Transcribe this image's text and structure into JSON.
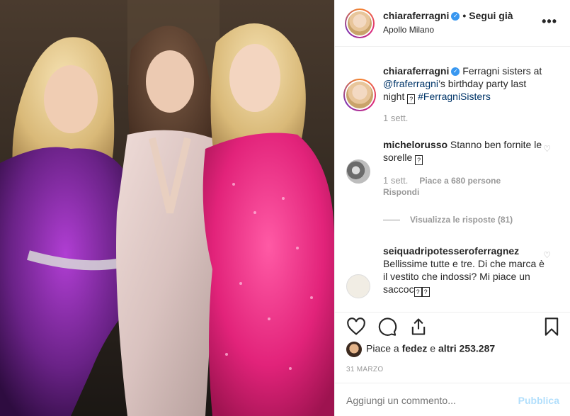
{
  "post": {
    "author": "chiaraferragni",
    "follow_label": "Segui già",
    "location": "Apollo Milano",
    "more_label": "•••"
  },
  "caption": {
    "username": "chiaraferragni",
    "text_before": " Ferragni sisters at ",
    "mention": "@fraferragni",
    "text_after": "’s birthday party last night ",
    "hashtag": "#FerragniSisters",
    "time": "1 sett."
  },
  "comments": [
    {
      "username": "michelorusso",
      "text": " Stanno ben fornite le sorelle ",
      "time": "1 sett.",
      "likes": "Piace a 680 persone",
      "reply": "Rispondi",
      "view_replies": "Visualizza le risposte (81)"
    },
    {
      "username": "seiquadripotesseroferragnez",
      "text": " Bellissime tutte e tre. Di che marca è il vestito che indossi? Mi piace un saccoc"
    }
  ],
  "likes": {
    "prefix": "Piace a ",
    "user": "fedez",
    "middle": " e ",
    "others": "altri 253.287"
  },
  "date": "31 MARZO",
  "add_comment": {
    "placeholder": "Aggiungi un commento...",
    "publish": "Pubblica"
  },
  "icons": [
    "verified-icon",
    "heart-icon",
    "comment-icon",
    "share-icon",
    "bookmark-icon"
  ],
  "colors": {
    "link": "#003569",
    "verified": "#3897f0",
    "muted": "#999999",
    "publish_disabled": "#b2dffc",
    "dress_pink": "#e2237a",
    "dress_purple": "#6a2287",
    "dress_satin": "#d9c2bf"
  }
}
